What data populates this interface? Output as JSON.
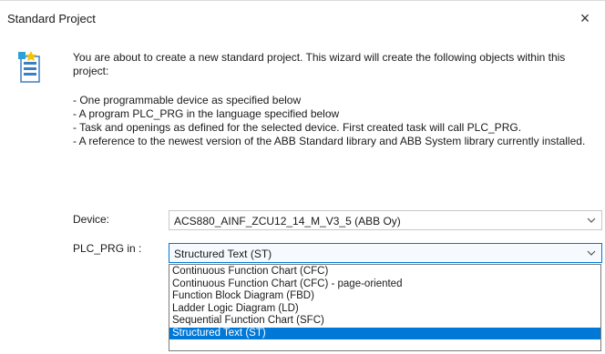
{
  "window": {
    "title": "Standard Project",
    "close_glyph": "×"
  },
  "intro_text": "You are about to create a new standard project. This wizard will create the following objects within this project:",
  "bullets": [
    "- One programmable device as specified below",
    "- A program PLC_PRG in the language specified below",
    "- Task and openings as defined for the selected device. First created task will call PLC_PRG.",
    "- A reference to the newest version of the ABB Standard library and ABB System library currently installed."
  ],
  "device": {
    "label": "Device:",
    "value": "ACS880_AINF_ZCU12_14_M_V3_5 (ABB Oy)"
  },
  "plc_prg": {
    "label": "PLC_PRG in :",
    "value": "Structured Text (ST)",
    "options": [
      "Continuous Function Chart (CFC)",
      "Continuous Function Chart (CFC) - page-oriented",
      "Function Block Diagram (FBD)",
      "Ladder Logic Diagram (LD)",
      "Sequential Function Chart (SFC)",
      "Structured Text (ST)"
    ],
    "selected_index": 5
  },
  "icons": {
    "wizard": "new-project-wizard-icon",
    "close": "close-icon",
    "chevron": "chevron-down-icon"
  },
  "colors": {
    "selection": "#0078d7",
    "focus_border": "#0078d7"
  }
}
